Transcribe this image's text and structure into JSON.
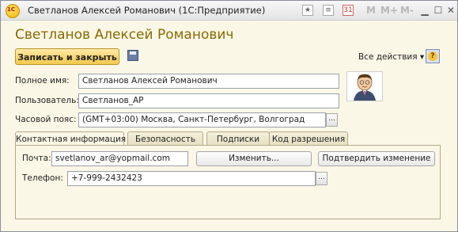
{
  "window": {
    "title": "Светланов Алексей Романович  (1С:Предприятие)",
    "logo_text": "1С",
    "toolbar_icons": [
      "star-icon",
      "list-icon",
      "calendar-icon"
    ],
    "memory_buttons": [
      "M",
      "M+",
      "M-"
    ],
    "window_buttons": [
      "minimize-icon",
      "maximize-icon",
      "close-icon"
    ]
  },
  "form": {
    "heading": "Светланов Алексей Романович",
    "save_close_label": "Записать и закрыть",
    "all_actions_label": "Все действия ▾",
    "help_label": "?",
    "full_name": {
      "label": "Полное имя:",
      "value": "Светланов Алексей Романович"
    },
    "user": {
      "label": "Пользователь:",
      "value": "Светланов_АР"
    },
    "timezone": {
      "label": "Часовой пояс:",
      "value": "(GMT+03:00) Москва, Санкт-Петербург, Волгоград",
      "button": "..."
    }
  },
  "tabs": [
    {
      "label": "Контактная информация",
      "active": true
    },
    {
      "label": "Безопасность",
      "active": false
    },
    {
      "label": "Подписки",
      "active": false
    },
    {
      "label": "Код разрешения",
      "active": false
    }
  ],
  "contact": {
    "email_label": "Почта:",
    "email_value": "svetlanov_ar@yopmail.com",
    "change_button": "Изменить...",
    "confirm_button": "Подтвердить изменение",
    "phone_label": "Телефон:",
    "phone_value": "+7-999-2432423",
    "phone_button": "..."
  },
  "colors": {
    "accent": "#8a6a00",
    "background": "#fbf7e6",
    "primary_button": "#f1c94d"
  }
}
